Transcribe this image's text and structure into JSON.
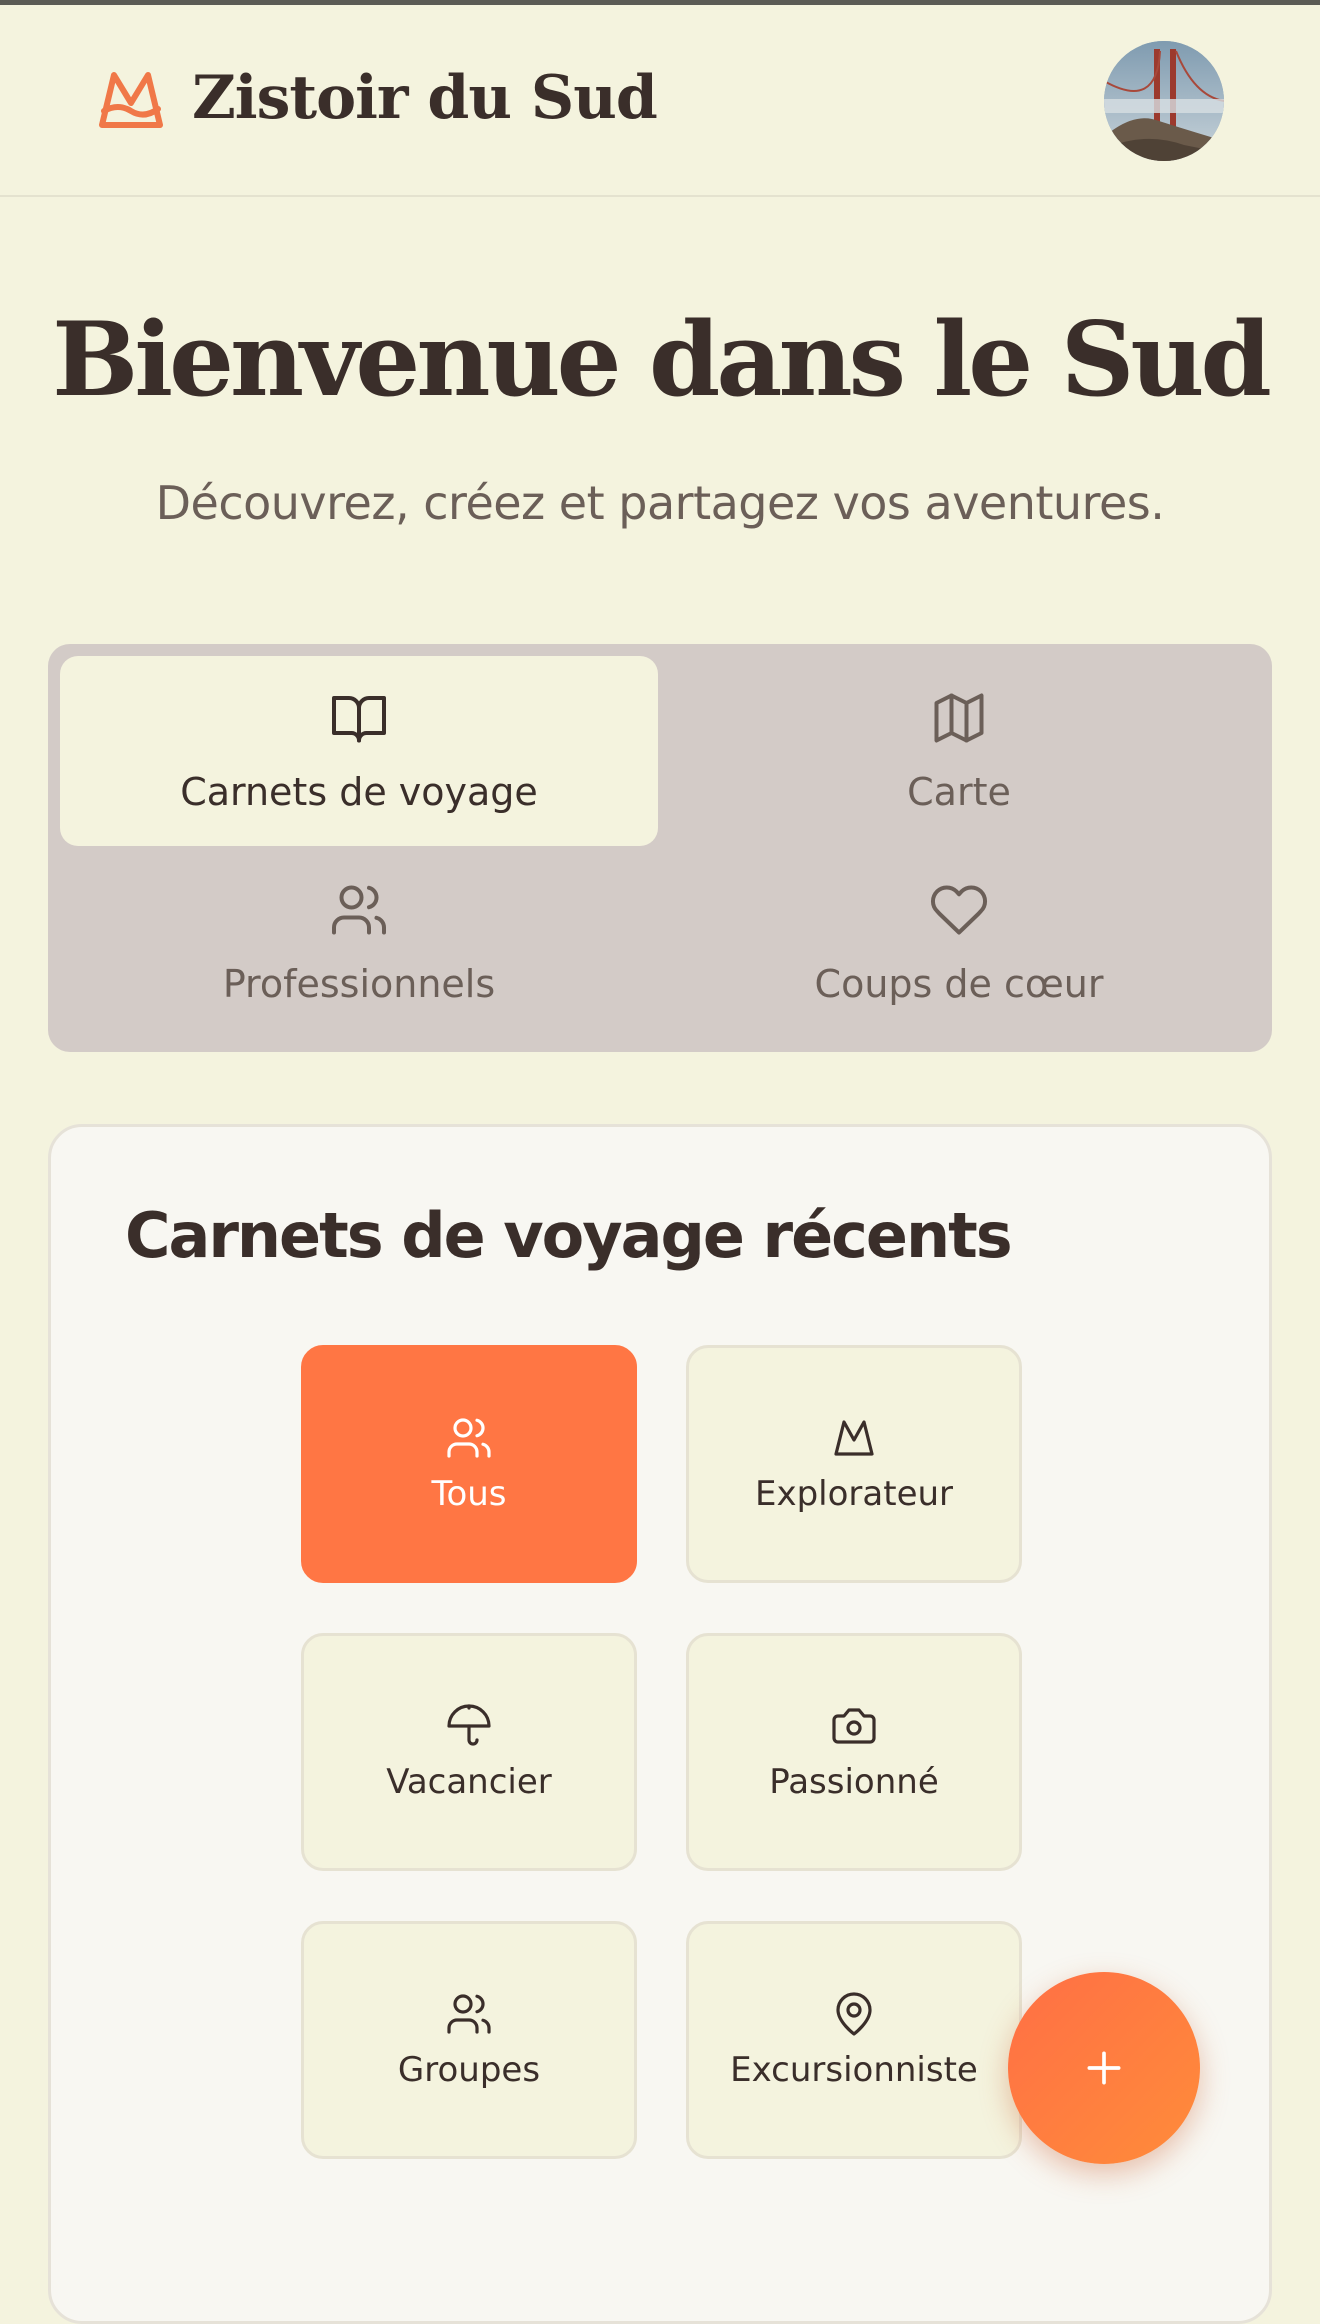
{
  "header": {
    "brand_name": "Zistoir du Sud",
    "logo_icon": "mountain-logo-icon",
    "avatar": "user-avatar"
  },
  "hero": {
    "title": "Bienvenue dans le Sud",
    "subtitle": "Découvrez, créez et partagez vos aventures."
  },
  "tabs": [
    {
      "label": "Carnets de voyage",
      "icon": "book-open-icon",
      "active": true
    },
    {
      "label": "Carte",
      "icon": "map-icon",
      "active": false
    },
    {
      "label": "Professionnels",
      "icon": "users-icon",
      "active": false
    },
    {
      "label": "Coups de cœur",
      "icon": "heart-icon",
      "active": false
    }
  ],
  "recent": {
    "title": "Carnets de voyage récents",
    "filters": [
      {
        "label": "Tous",
        "icon": "users-icon",
        "active": true
      },
      {
        "label": "Explorateur",
        "icon": "mountain-icon",
        "active": false
      },
      {
        "label": "Vacancier",
        "icon": "umbrella-icon",
        "active": false
      },
      {
        "label": "Passionné",
        "icon": "camera-icon",
        "active": false
      },
      {
        "label": "Groupes",
        "icon": "users-icon",
        "active": false
      },
      {
        "label": "Excursionniste",
        "icon": "map-pin-icon",
        "active": false
      }
    ]
  },
  "fab": {
    "icon": "plus-icon"
  },
  "colors": {
    "background": "#f4f3de",
    "accent": "#ff7644",
    "text": "#3a2e2a",
    "tabs_bg": "#d3cbc7"
  }
}
